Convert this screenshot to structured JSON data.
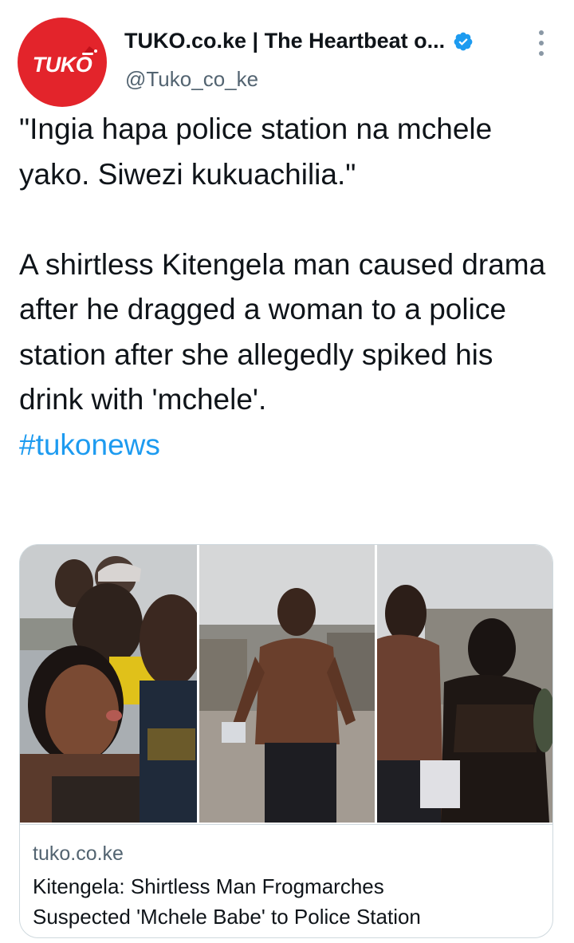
{
  "account": {
    "avatar_text": "TUKO",
    "display_name": "TUKO.co.ke | The Heartbeat o...",
    "handle": "@Tuko_co_ke",
    "verified": true,
    "verified_icon": "verified-badge-icon",
    "more_icon": "more-options-icon"
  },
  "tweet": {
    "quote": "\"Ingia hapa police station na mchele yako. Siwezi kukuachilia.\"",
    "body": "A shirtless Kitengela man caused drama after he dragged a woman to a police station after she allegedly spiked his drink with 'mchele'.",
    "hashtag": "#tukonews"
  },
  "card": {
    "domain": "tuko.co.ke",
    "title_line1": "Kitengela: Shirtless Man Frogmarches",
    "title_line2": "Suspected 'Mchele Babe' to Police Station",
    "images": [
      "crowd-photo",
      "shirtless-man-photo",
      "man-and-woman-photo"
    ]
  },
  "colors": {
    "brand_red": "#e3242b",
    "link_blue": "#1d9bf0",
    "text_primary": "#0f1419",
    "text_secondary": "#536471",
    "border": "#cfd9de"
  }
}
